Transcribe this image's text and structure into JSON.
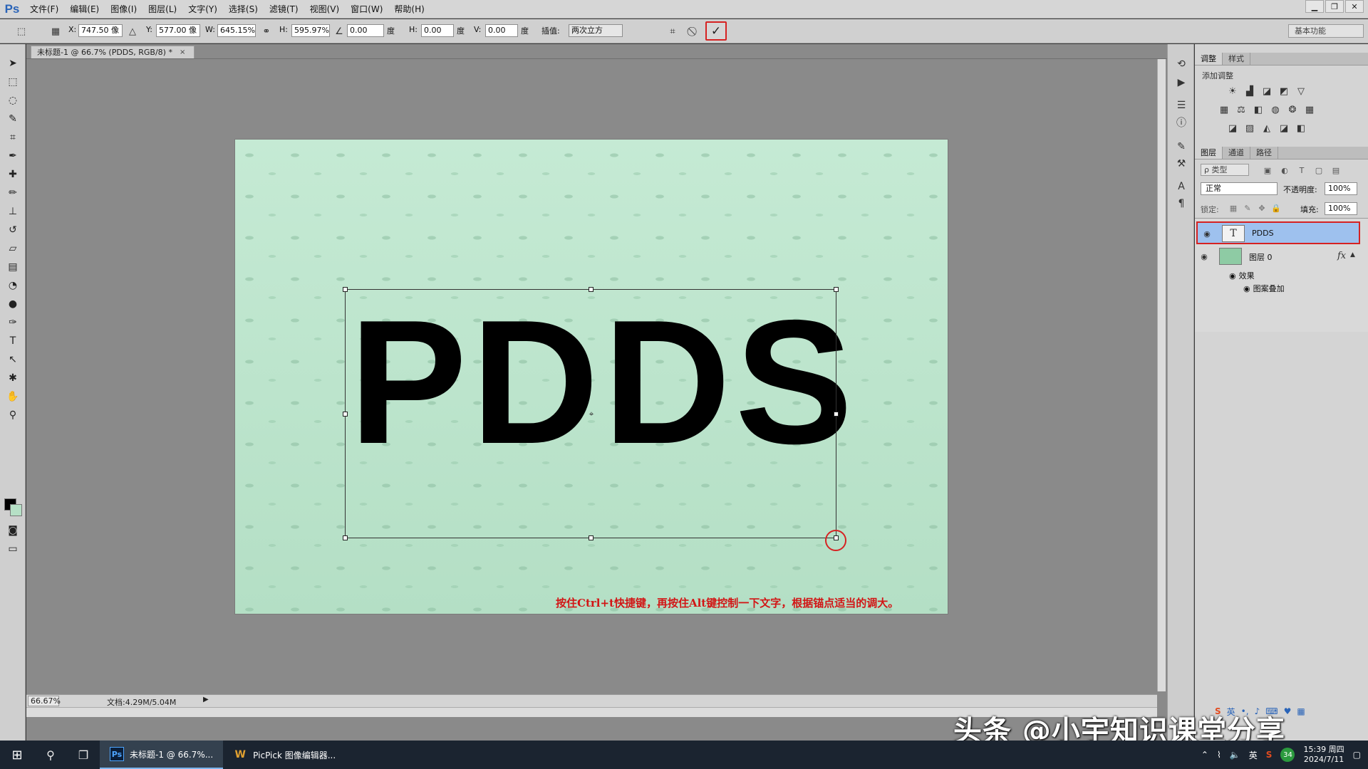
{
  "app": {
    "logo": "Ps"
  },
  "menu": [
    "文件(F)",
    "编辑(E)",
    "图像(I)",
    "图层(L)",
    "文字(Y)",
    "选择(S)",
    "滤镜(T)",
    "视图(V)",
    "窗口(W)",
    "帮助(H)"
  ],
  "window_controls": {
    "minimize": "▁",
    "restore": "❐",
    "close": "✕"
  },
  "options_bar": {
    "x_label": "X:",
    "x_value": "747.50 像",
    "y_label": "Y:",
    "y_value": "577.00 像",
    "w_label": "W:",
    "w_value": "645.15%",
    "h_label": "H:",
    "h_value": "595.97%",
    "angle_value": "0.00",
    "angle_unit": "度",
    "hskew_label": "H:",
    "hskew_value": "0.00",
    "hskew_unit": "度",
    "vskew_label": "V:",
    "vskew_value": "0.00",
    "vskew_unit": "度",
    "interp_label": "插值:",
    "interp_value": "两次立方",
    "commit_symbol": "✓",
    "cancel_symbol": "⃠",
    "workspace": "基本功能"
  },
  "document": {
    "tab_title": "未标题-1 @ 66.7% (PDDS, RGB/8) *",
    "tab_close": "×",
    "canvas_text": "PDDS",
    "instruction": "按住Ctrl+t快捷键，再按住Alt键控制一下文字，根据锚点适当的调大。",
    "bg_color": "#bfe6cf"
  },
  "status": {
    "zoom": "66.67%",
    "doc_info": "文档:4.29M/5.04M",
    "arrow": "▶"
  },
  "panels": {
    "adjust_tabs": [
      "调整",
      "样式"
    ],
    "adjust_title": "添加调整",
    "layers_tabs": [
      "图层",
      "通道",
      "路径"
    ],
    "search_placeholder": "ρ 类型",
    "blend_mode": "正常",
    "opacity_label": "不透明度:",
    "opacity_value": "100%",
    "lock_label": "锁定:",
    "fill_label": "填充:",
    "fill_value": "100%",
    "layers": [
      {
        "name": "PDDS",
        "type": "text",
        "thumb": "T",
        "selected": true
      },
      {
        "name": "图层 0",
        "type": "pixel",
        "fx": "fx"
      }
    ],
    "effects_label": "效果",
    "effect_item": "图案叠加"
  },
  "ime": {
    "logo": "S",
    "lang": "英"
  },
  "watermark": "头条 @小宇知识课堂分享",
  "taskbar": {
    "apps": [
      {
        "label": "未标题-1 @ 66.7%...",
        "icon": "Ps"
      },
      {
        "label": "PicPick 图像编辑器...",
        "icon": "W"
      }
    ],
    "tray_lang": "英",
    "badge": "34",
    "time": "15:39 周四",
    "date": "2024/7/11"
  },
  "colors": {
    "accent_red": "#d62222",
    "selection_blue": "#9ec1ee",
    "canvas_green": "#bfe6cf"
  }
}
